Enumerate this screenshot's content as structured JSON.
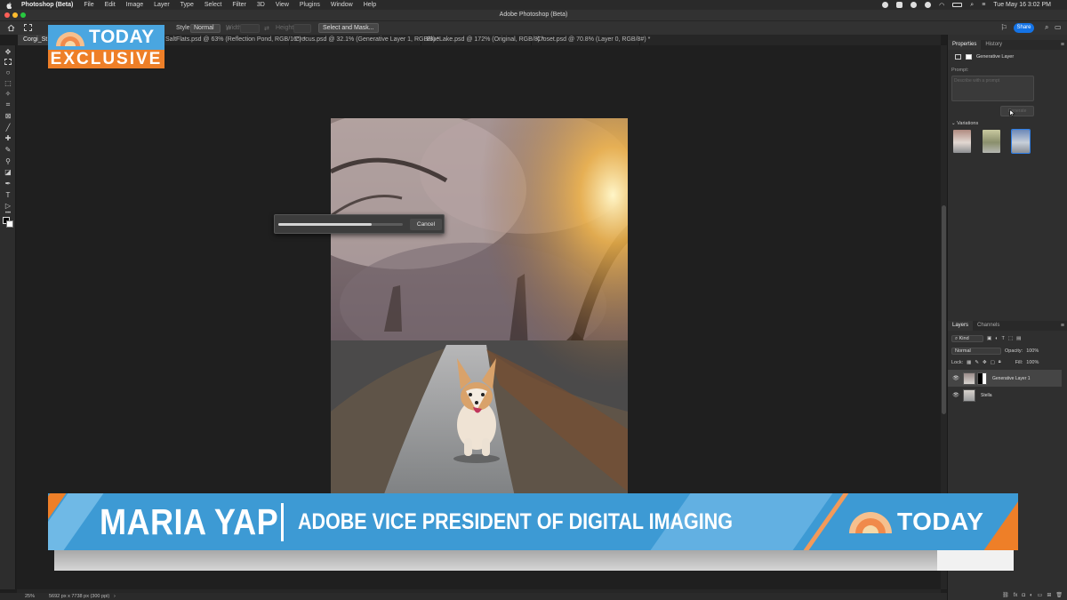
{
  "menubar": {
    "app_name": "Photoshop (Beta)",
    "items": [
      "File",
      "Edit",
      "Image",
      "Layer",
      "Type",
      "Select",
      "Filter",
      "3D",
      "View",
      "Plugins",
      "Window",
      "Help"
    ],
    "clock": "Tue May 16  3:02 PM"
  },
  "window": {
    "title": "Adobe Photoshop (Beta)"
  },
  "options": {
    "style_label": "Style:",
    "style_value": "Normal",
    "width_label": "Width:",
    "height_label": "Height:",
    "select_mask": "Select and Mask...",
    "share": "Share"
  },
  "tabs": [
    {
      "label": "Corgi_St"
    },
    {
      "label": "SaltFlats.psd @ 63% (Reflection Pond, RGB/16*) *"
    },
    {
      "label": "Crocus.psd @ 32.1% (Generative Layer 1, RGB/8) *"
    },
    {
      "label": "BlueLake.psd @ 172% (Original, RGB/8) *"
    },
    {
      "label": "Closet.psd @ 70.8% (Layer 0, RGB/8#) *"
    }
  ],
  "progress_dialog": {
    "cancel": "Cancel",
    "progress": 0.75
  },
  "status": {
    "zoom": "25%",
    "dims": "5692 px x 7738 px (300 ppi)"
  },
  "properties": {
    "tabs": [
      "Properties",
      "History"
    ],
    "layer_type": "Generative Layer",
    "prompt_label": "Prompt:",
    "prompt_placeholder": "Describe with a prompt",
    "generate": "Generate",
    "variations_label": "Variations"
  },
  "layers": {
    "tabs": [
      "Layers",
      "Channels"
    ],
    "filter": "Kind",
    "blend_mode": "Normal",
    "opacity_label": "Opacity:",
    "opacity_value": "100%",
    "lock_label": "Lock:",
    "fill_label": "Fill:",
    "fill_value": "100%",
    "items": [
      {
        "name": "Generative Layer 1",
        "active": true
      },
      {
        "name": "Stella",
        "active": false
      }
    ]
  },
  "overlay": {
    "bug_logo": "TODAY",
    "bug_tag": "EXCLUSIVE",
    "name": "MARIA YAP",
    "title": "ADOBE VICE PRESIDENT OF DIGITAL IMAGING",
    "logo": "TODAY"
  },
  "colors": {
    "today_blue": "#3d9ad4",
    "today_orange": "#ee7f28",
    "accent": "#1473e6"
  }
}
